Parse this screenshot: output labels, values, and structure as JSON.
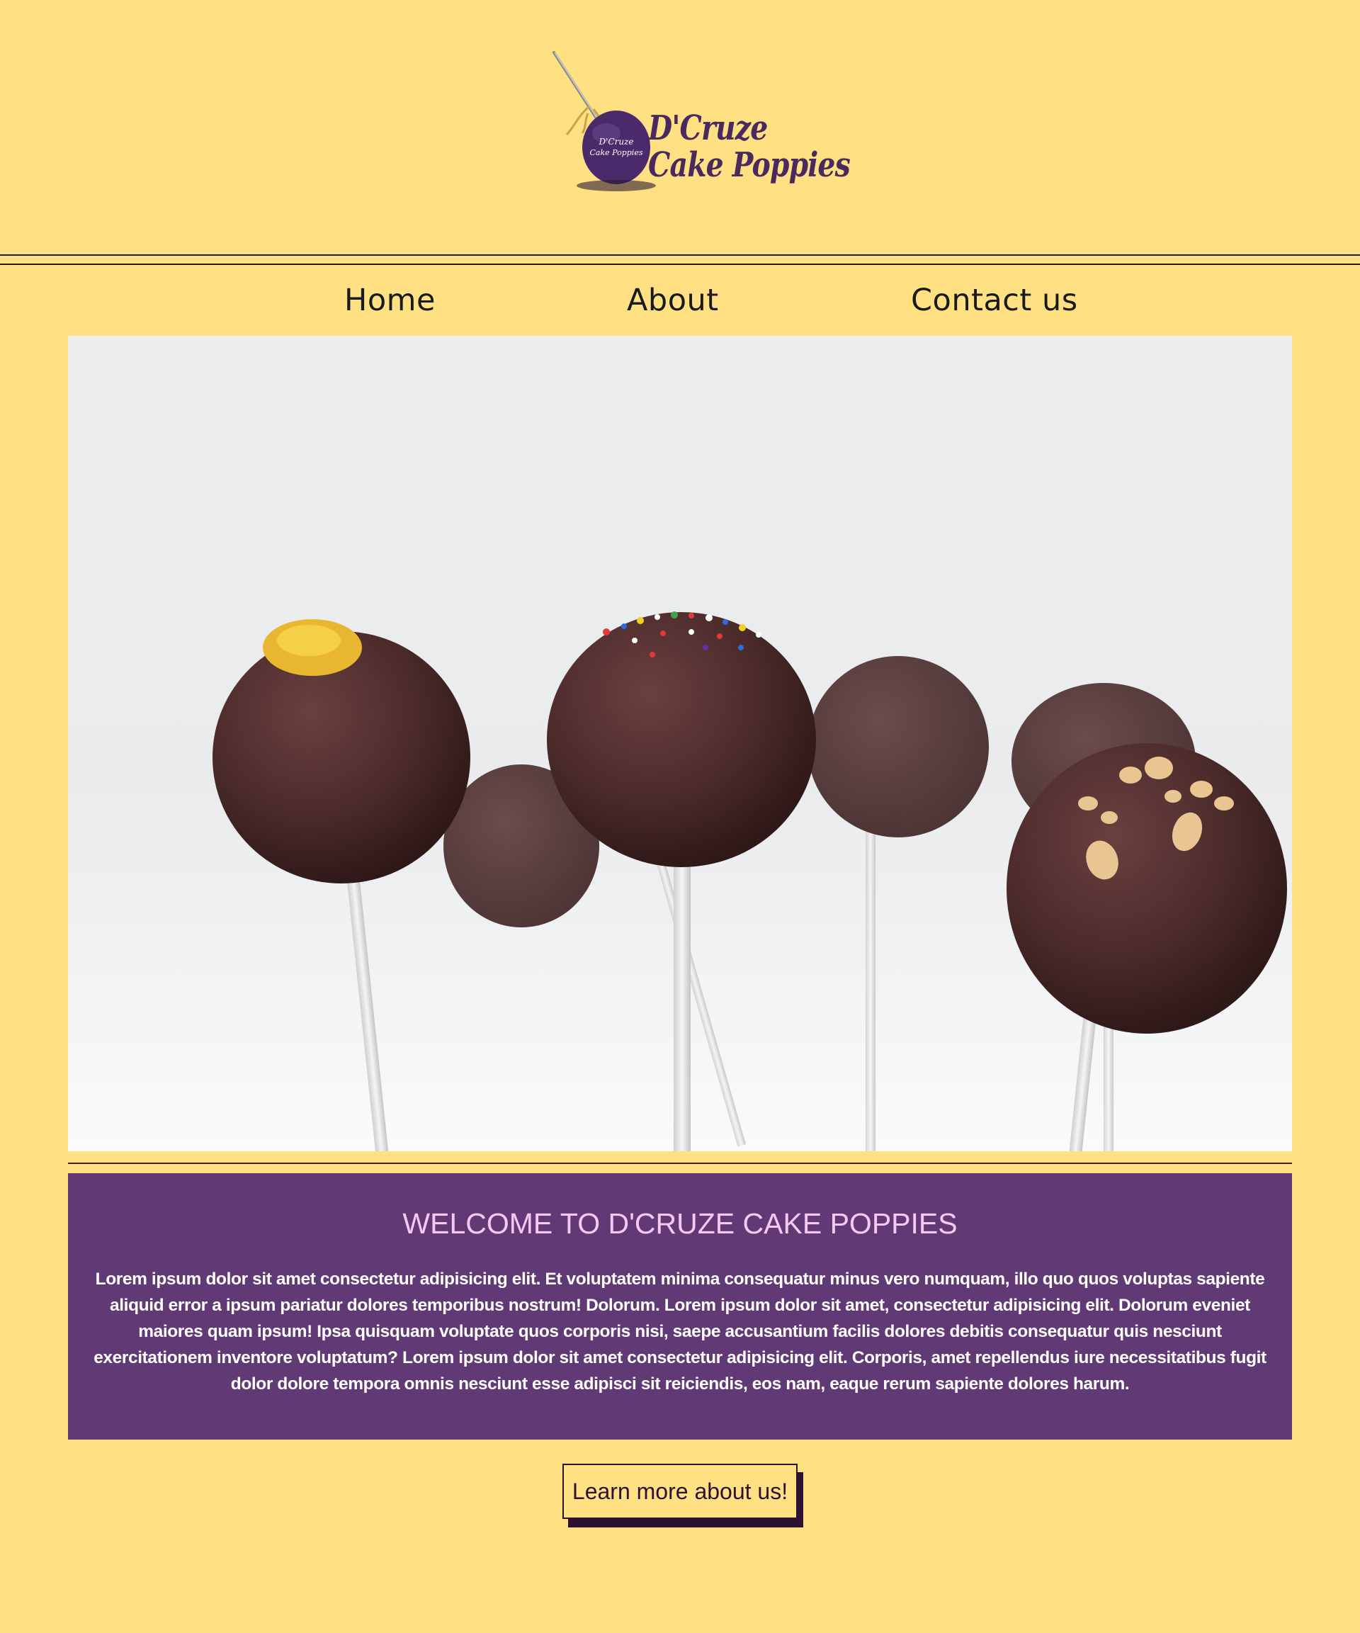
{
  "brand": {
    "name_line1": "D'Cruze",
    "name_line2": "Cake Poppies",
    "badge_line1": "D'Cruze",
    "badge_line2": "Cake Poppies",
    "primary_color": "#613a75",
    "background_color": "#ffe184"
  },
  "nav": {
    "items": [
      {
        "label": "Home"
      },
      {
        "label": "About"
      },
      {
        "label": "Contact us"
      }
    ]
  },
  "hero": {
    "icon": "cake-pops-photo"
  },
  "welcome": {
    "title": "WELCOME TO D'CRUZE CAKE POPPIES",
    "body": "Lorem ipsum dolor sit amet consectetur adipisicing elit. Et voluptatem minima consequatur minus vero numquam, illo quo quos voluptas sapiente aliquid error a ipsum pariatur dolores temporibus nostrum! Dolorum. Lorem ipsum dolor sit amet, consectetur adipisicing elit. Dolorum eveniet maiores quam ipsum! Ipsa quisquam voluptate quos corporis nisi, saepe accusantium facilis dolores debitis consequatur quis nesciunt exercitationem inventore voluptatum? Lorem ipsum dolor sit amet consectetur adipisicing elit. Corporis, amet repellendus iure necessitatibus fugit dolor dolore tempora omnis nesciunt esse adipisci sit reiciendis, eos nam, eaque rerum sapiente dolores harum."
  },
  "cta": {
    "label": "Learn more about us!"
  }
}
